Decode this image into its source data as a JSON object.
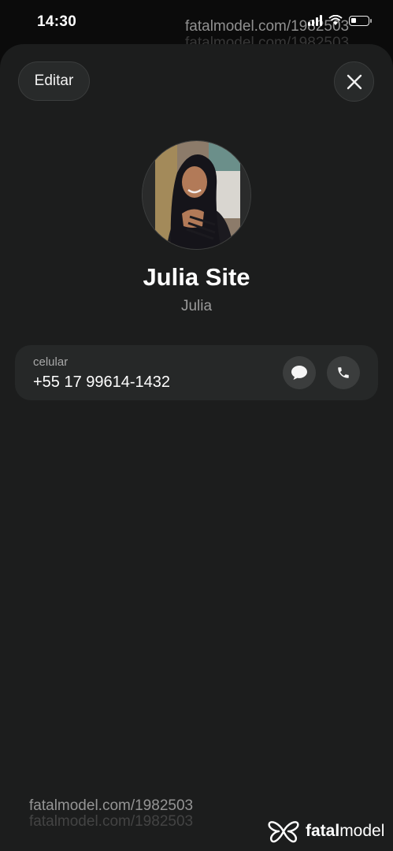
{
  "status_bar": {
    "time": "14:30",
    "watermark": "fatalmodel.com/1982503"
  },
  "header": {
    "edit_label": "Editar",
    "close_icon": "close-icon"
  },
  "contact": {
    "name": "Julia Site",
    "subname": "Julia",
    "avatar": "avatar-photo"
  },
  "phone": {
    "label": "celular",
    "number": "+55 17 99614-1432",
    "message_icon": "message-bubble-icon",
    "call_icon": "phone-icon"
  },
  "footer": {
    "watermark": "fatalmodel.com/1982503",
    "brand_bold": "fatal",
    "brand_regular": "model"
  },
  "colors": {
    "sheet_bg": "#1c1d1d",
    "card_bg": "#262828",
    "button_bg": "#3b3d3d"
  }
}
